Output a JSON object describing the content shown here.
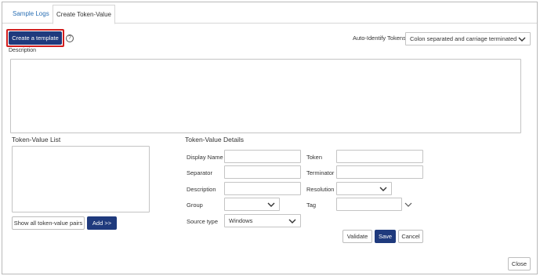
{
  "tabs": [
    {
      "label": "Sample Logs",
      "active": false
    },
    {
      "label": "Create Token-Value",
      "active": true
    }
  ],
  "toolbar": {
    "create_template_label": "Create a template",
    "help_glyph": "?",
    "auto_identify_label": "Auto-Identify Tokens",
    "auto_identify_value": "Colon separated and carriage terminated"
  },
  "description": {
    "label": "Description",
    "value": ""
  },
  "token_value_list": {
    "title": "Token-Value List",
    "show_all_label": "Show all token-value pairs",
    "add_label": "Add >>"
  },
  "details": {
    "title": "Token-Value Details",
    "display_name_label": "Display Name",
    "token_label": "Token",
    "separator_label": "Separator",
    "terminator_label": "Terminator",
    "description_label": "Description",
    "resolution_label": "Resolution",
    "group_label": "Group",
    "tag_label": "Tag",
    "source_type_label": "Source type",
    "source_type_value": "Windows",
    "validate_label": "Validate",
    "save_label": "Save",
    "cancel_label": "Cancel"
  },
  "footer": {
    "close_label": "Close"
  },
  "colors": {
    "primary": "#1f3a7d",
    "highlight": "#d21e1e",
    "link": "#2a6fb4"
  },
  "icons": {
    "help": "help-icon",
    "dropdown": "chevron-down-icon"
  }
}
